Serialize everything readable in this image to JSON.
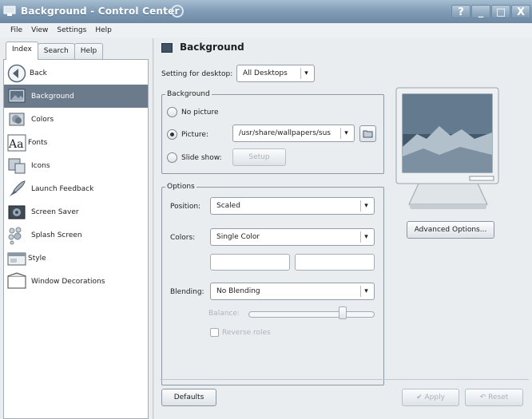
{
  "window": {
    "title": "Background - Control Center",
    "controls": [
      "?",
      "_",
      "□",
      "X"
    ]
  },
  "menu": [
    "File",
    "View",
    "Settings",
    "Help"
  ],
  "sidebar": {
    "tabs": [
      "Index",
      "Search",
      "Help"
    ],
    "active_tab": "Index",
    "items": [
      {
        "label": "Back",
        "icon": "back-arrow-icon"
      },
      {
        "label": "Background",
        "icon": "background-icon",
        "selected": true
      },
      {
        "label": "Colors",
        "icon": "colors-icon"
      },
      {
        "label": "Fonts",
        "icon": "fonts-icon"
      },
      {
        "label": "Icons",
        "icon": "icons-icon"
      },
      {
        "label": "Launch Feedback",
        "icon": "launch-feedback-icon"
      },
      {
        "label": "Screen Saver",
        "icon": "screen-saver-icon"
      },
      {
        "label": "Splash Screen",
        "icon": "splash-screen-icon"
      },
      {
        "label": "Style",
        "icon": "style-icon"
      },
      {
        "label": "Window Decorations",
        "icon": "window-decorations-icon"
      }
    ]
  },
  "main": {
    "header_title": "Background",
    "setting_for_label": "Setting for desktop:",
    "setting_for_value": "All Desktops",
    "background_group": {
      "title": "Background",
      "no_picture_label": "No picture",
      "picture_label": "Picture:",
      "picture_path": "/usr/share/wallpapers/sus",
      "slideshow_label": "Slide show:",
      "setup_label": "Setup",
      "selected": "Picture:"
    },
    "options_group": {
      "title": "Options",
      "position_label": "Position:",
      "position_value": "Scaled",
      "colors_label": "Colors:",
      "colors_value": "Single Color",
      "blending_label": "Blending:",
      "blending_value": "No Blending",
      "balance_label": "Balance:",
      "balance_value": 0.76,
      "reverse_roles_label": "Reverse roles",
      "reverse_roles_checked": false
    },
    "advanced_options_label": "Advanced Options...",
    "defaults_label": "Defaults",
    "apply_label": "Apply",
    "reset_label": "Reset"
  },
  "colors": {
    "titlebar": "#839eb8",
    "selection": "#6b7b8b",
    "window_bg": "#e9edf0"
  }
}
